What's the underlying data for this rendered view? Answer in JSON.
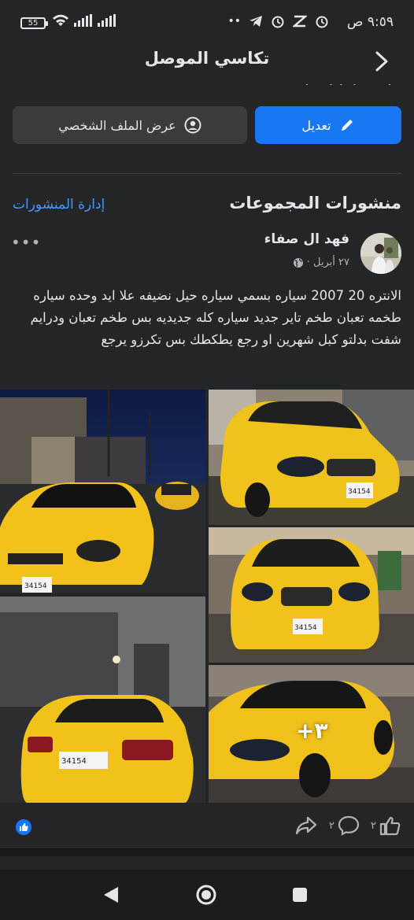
{
  "status_bar": {
    "time": "٩:٥٩ ص",
    "battery": "55"
  },
  "header": {
    "title": "تكاسي الموصل"
  },
  "buttons": {
    "edit_label": "تعديل",
    "view_profile_label": "عرض الملف الشخصي"
  },
  "section": {
    "title": "منشورات المجموعات",
    "manage_label": "إدارة المنشورات"
  },
  "post": {
    "author": "فهد ال صفاء",
    "date": "٢٧ أبريل ·",
    "text": "الانتره 20 2007 سياره بسمي سياره حيل نضيفه علا ايد وحده سياره طخمه تعبان طخم تاير جديد سياره كله جديديه بس طخم تعبان ودرايم شفت بدلتو كبل شهرين او رجع يطكطك بس تكرزو يرجع",
    "more_photos": "+٣",
    "likes_count": "٢",
    "comments_count": "٢"
  },
  "colors": {
    "accent": "#1877f2",
    "background": "#242526",
    "link": "#4599ff"
  }
}
